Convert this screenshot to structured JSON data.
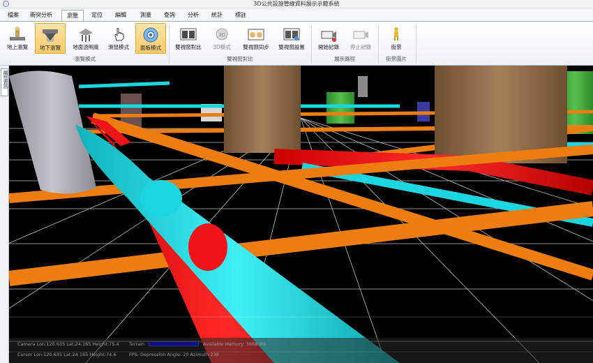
{
  "window": {
    "title": "3D公共設施管線資料展示示範系統"
  },
  "tabs": [
    "檔案",
    "衝突分析",
    "瀏覽",
    "定位",
    "編輯",
    "測量",
    "查詢",
    "分析",
    "統計",
    "標註"
  ],
  "active_tab": "瀏覽",
  "ribbon": {
    "buttons": {
      "ground_browse": "地上瀏覽",
      "underground_browse": "地下瀏覽",
      "ground_transparency": "地面透明度",
      "mouse_mode": "滑鼠模式",
      "panel_mode": "面板模式",
      "dual_compare": "雙視窗對比",
      "mode_3d": "3D模式",
      "dual_sync": "雙視窗同步",
      "dual_settings": "雙視窗設置",
      "start_record": "開始記錄",
      "stop_record": "停止記錄",
      "street_view": "街景"
    },
    "groups": {
      "browse_mode": "瀏覽模式",
      "dual_compare": "雙視窗對比",
      "display_path": "展示路徑",
      "street_image": "街景圖片"
    }
  },
  "side_panel": {
    "tab_label": "屬性資訊"
  },
  "status": {
    "camera": "Camera Lon:120.635 Lat:24.165 Height:75.4",
    "cursor": "Cursor Lon:120.635 Lat:24.165 Height:74.6",
    "terrain_label": "Terrain",
    "memory": "Available Memory: 3668 MB",
    "fps": "FPS: Depression Angle: 20  Azimuth:238"
  },
  "colors": {
    "accent_tab": "#9aaec7",
    "selected_button": "#f9c96a",
    "pipe_cyan": "#19d6e0",
    "pipe_red": "#f0141a",
    "pipe_orange": "#ee7d10",
    "grid": "#ffffff",
    "building_brown": "#8b6a46",
    "building_green": "#3fa33a"
  }
}
